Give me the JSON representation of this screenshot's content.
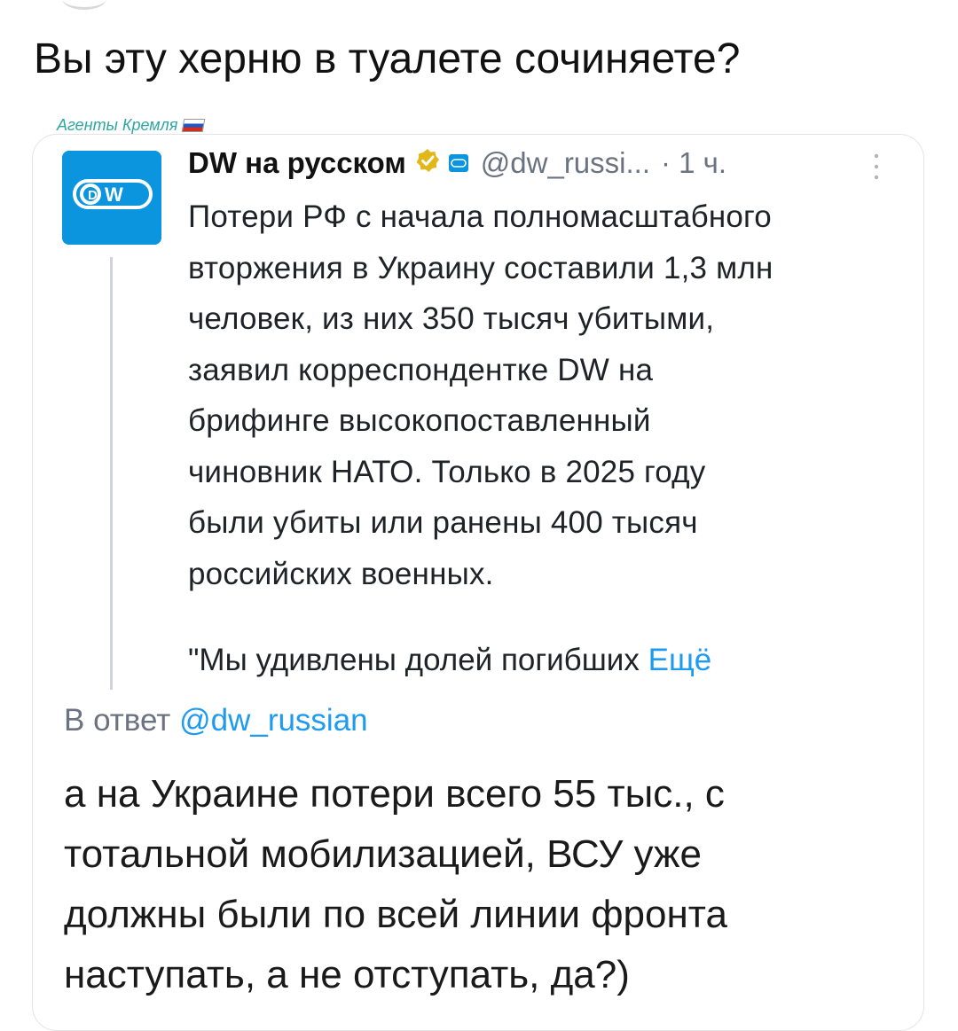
{
  "post": {
    "headline": "Вы эту херню в туалете сочиняете?",
    "group_label": "Агенты Кремля"
  },
  "quoted_tweet": {
    "author_name": "DW на русском",
    "handle": "@dw_russi...",
    "time": "· 1 ч.",
    "text_lines": [
      "Потери РФ с начала полномасштабного",
      "вторжения в Украину составили 1,3 млн",
      "человек, из них 350 тысяч убитыми,",
      "заявил корреспондентке DW на",
      "брифинге высокопоставленный",
      "чиновник НАТО. Только в 2025 году",
      "были убиты или ранены 400 тысяч",
      "российских военных."
    ],
    "quote_line": "\"Мы удивлены долей погибших",
    "more_label": "Ещё"
  },
  "reply": {
    "reply_prefix": "В ответ",
    "reply_handle": "@dw_russian",
    "text_lines": [
      "а на Украине потери всего 55 тыс., с",
      "тотальной мобилизацией, ВСУ уже",
      "должны были по всей линии фронта",
      "наступать, а не отступать, да?)"
    ]
  },
  "icons": {
    "avatar": "dw-logo-icon",
    "verified": "verified-badge-icon",
    "affiliation": "dw-affiliation-badge-icon",
    "more": "more-options-icon",
    "flag": "russian-flag-icon"
  },
  "colors": {
    "brand_blue": "#0a95de",
    "link_blue": "#1d9bf0",
    "verified_gold": "#e2b719",
    "label_teal": "#2fa7a0",
    "muted_gray": "#6b7280"
  }
}
